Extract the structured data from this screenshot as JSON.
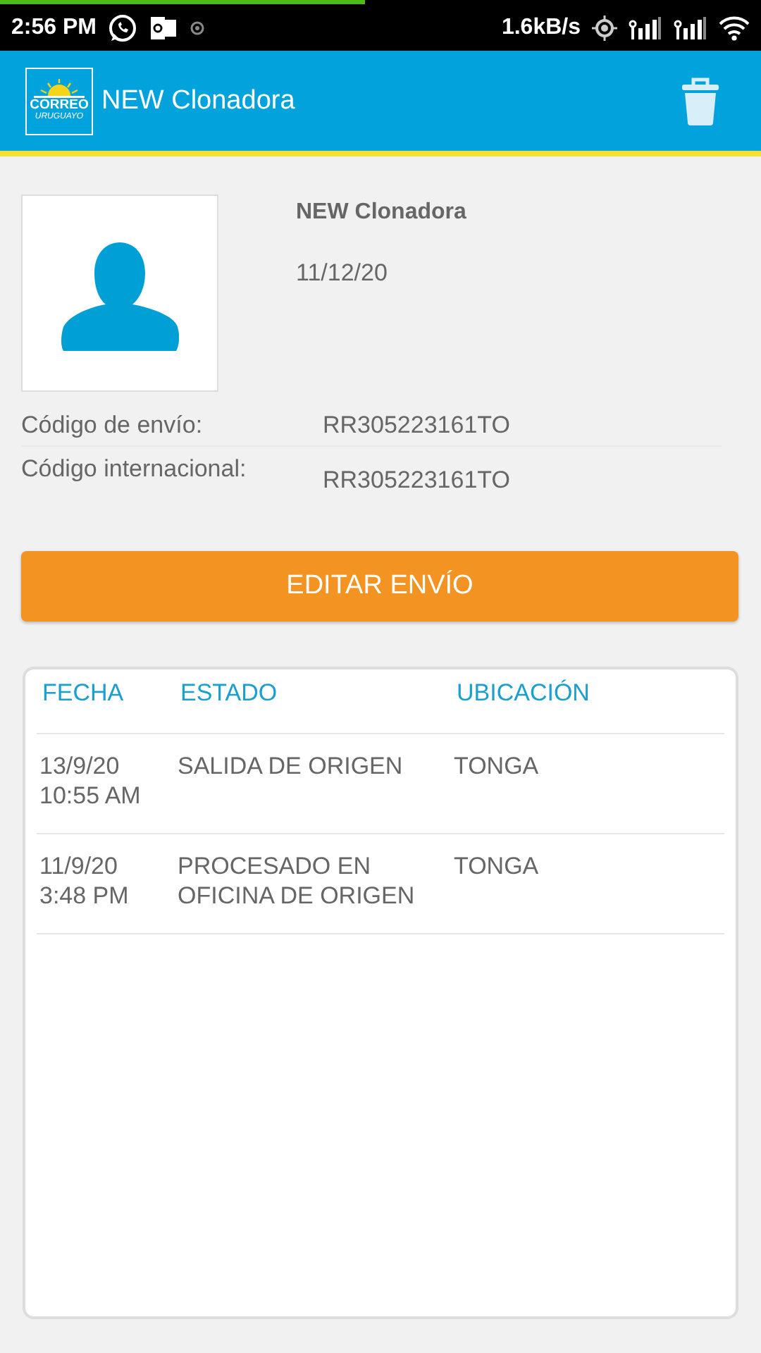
{
  "status_bar": {
    "time": "2:56 PM",
    "speed": "1.6kB/s",
    "loading": {
      "level": 0.48
    }
  },
  "app_bar": {
    "logo": {
      "name": "CORREO",
      "subtitle": "URUGUAYO"
    },
    "title": "NEW Clonadora"
  },
  "profile": {
    "name": "NEW Clonadora",
    "date": "11/12/20"
  },
  "codes": [
    {
      "label": "Código de envío:",
      "value": "RR305223161TO"
    },
    {
      "label": "Código internacional:",
      "value": "RR305223161TO"
    }
  ],
  "edit_button": "EDITAR ENVÍO",
  "table": {
    "columns": [
      "FECHA",
      "ESTADO",
      "UBICACIÓN"
    ],
    "rows": [
      [
        "13/9/20\n10:55 AM",
        "SALIDA DE ORIGEN",
        "TONGA"
      ],
      [
        "11/9/20\n3:48 PM",
        "PROCESADO EN OFICINA DE ORIGEN",
        "TONGA"
      ]
    ]
  }
}
